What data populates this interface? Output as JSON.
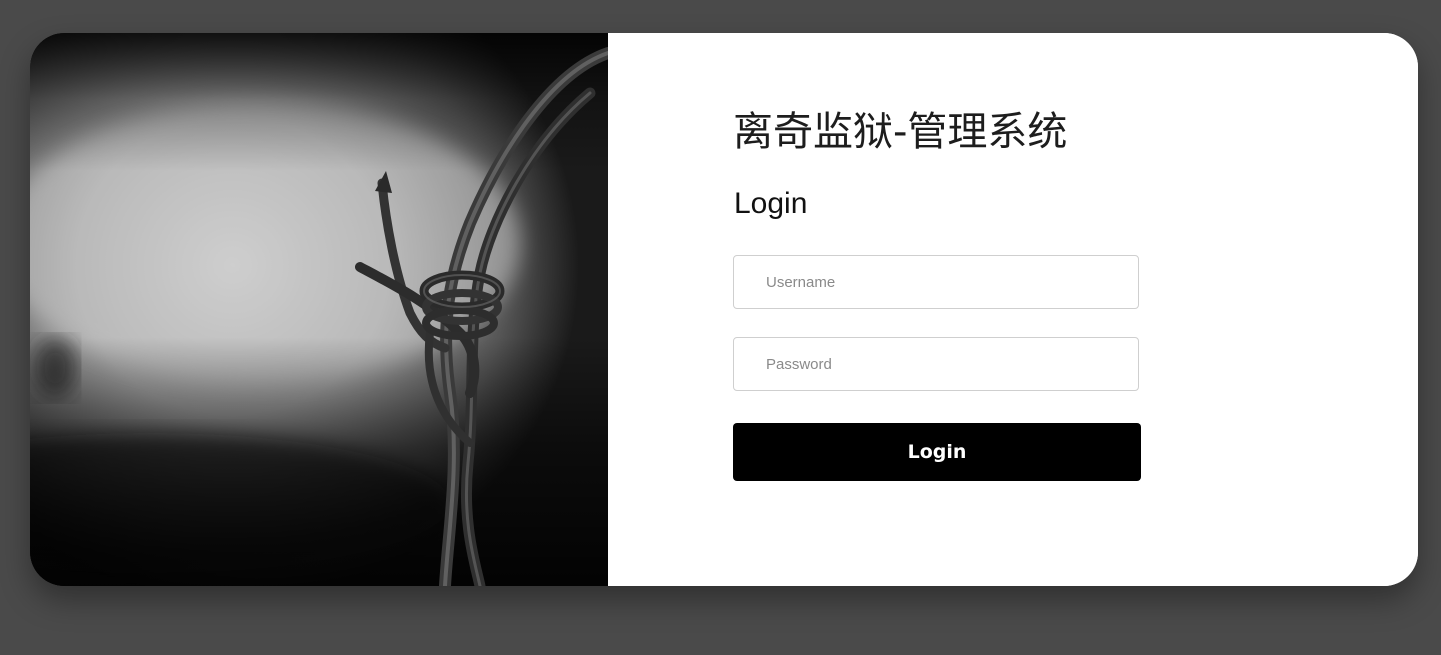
{
  "app": {
    "title": "离奇监狱-管理系统"
  },
  "form": {
    "heading": "Login",
    "username_placeholder": "Username",
    "password_placeholder": "Password",
    "submit_label": "Login"
  },
  "image": {
    "subject": "barbed-wire"
  },
  "colors": {
    "page_background": "#4a4a4a",
    "card_background": "#ffffff",
    "button_background": "#000000",
    "button_text": "#ffffff"
  }
}
